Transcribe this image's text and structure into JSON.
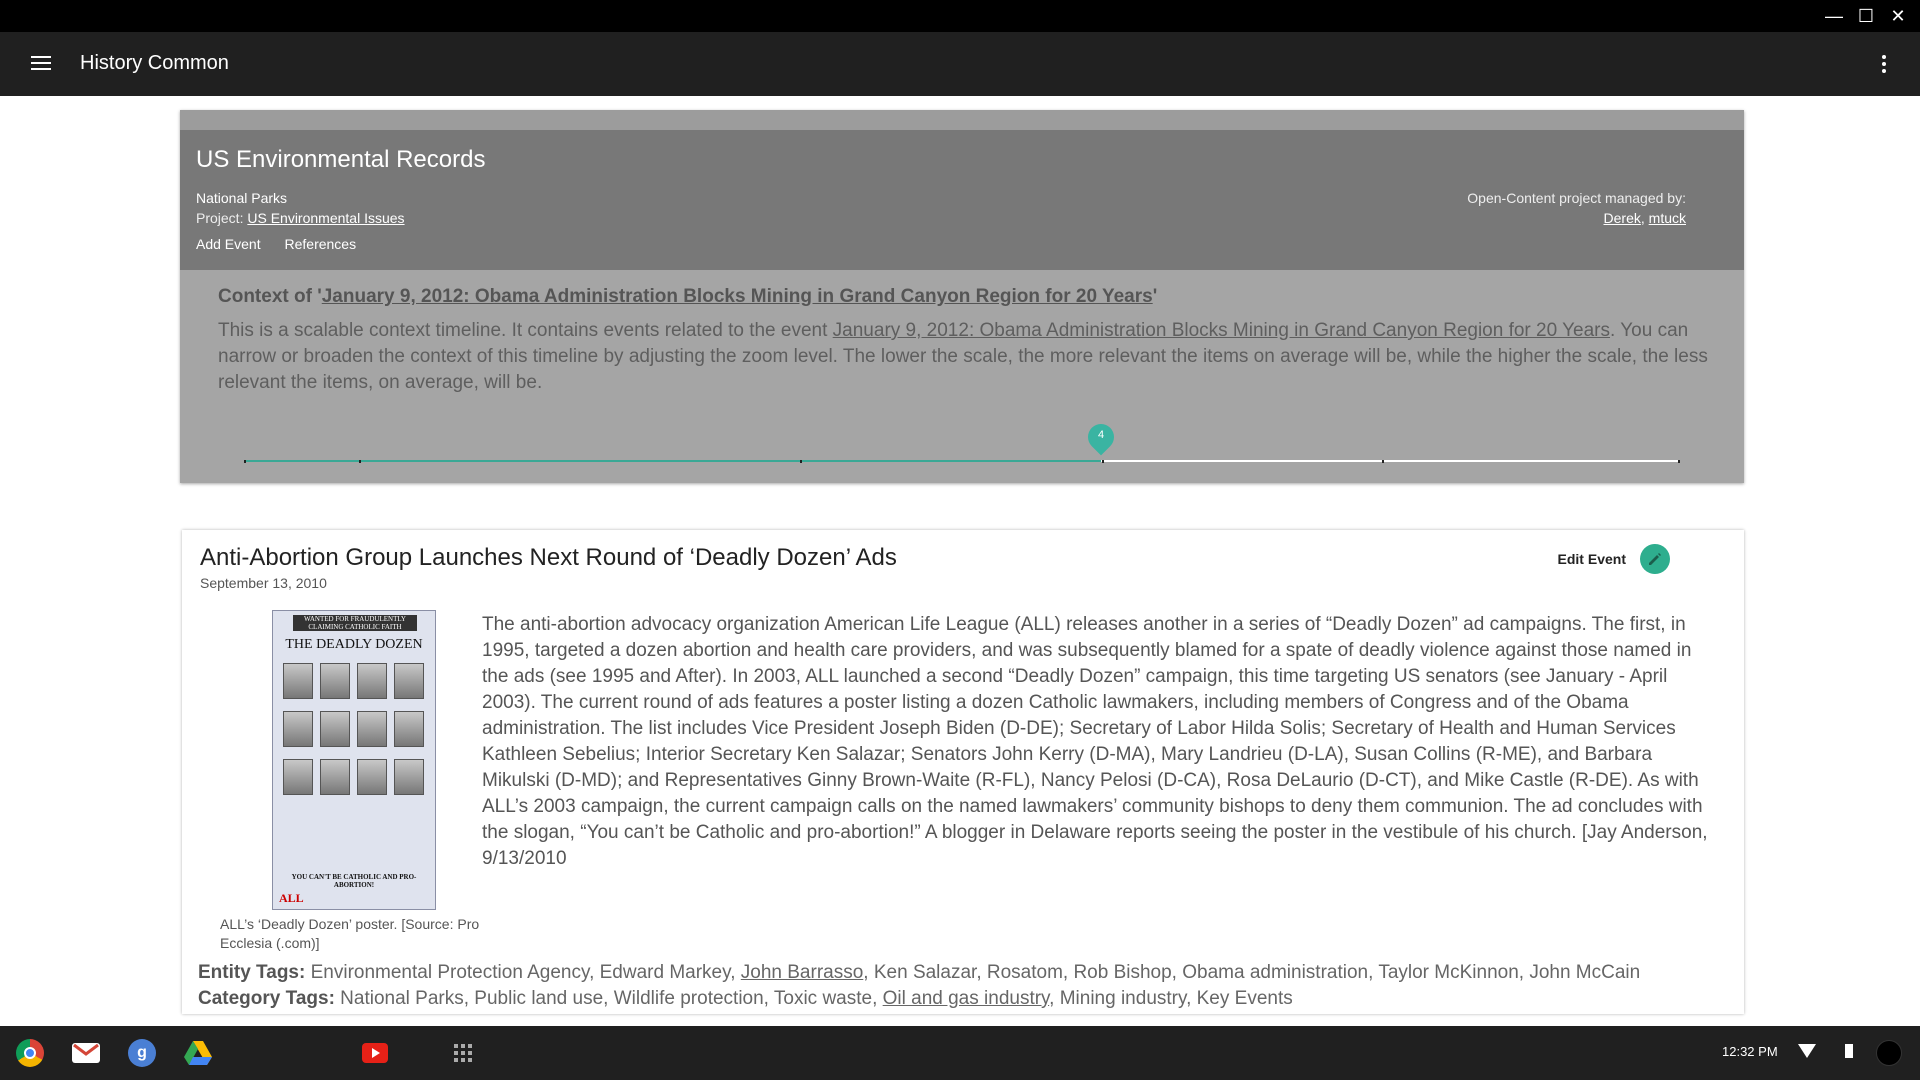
{
  "window": {
    "minimize": "—",
    "maximize": "☐",
    "close": "✕"
  },
  "appbar": {
    "title": "History Common"
  },
  "header": {
    "site_title": "US Environmental Records",
    "section": "National Parks",
    "project_label": "Project: ",
    "project_link": "US Environmental Issues",
    "nav": [
      "Add Event",
      "References"
    ],
    "managed_label": "Open-Content project managed by:",
    "managers": [
      "Derek",
      "mtuck"
    ]
  },
  "context": {
    "title_prefix": "Context of '",
    "title_link": "January 9, 2012: Obama Administration Blocks Mining in Grand Canyon Region for 20 Years",
    "title_suffix": "'",
    "desc_1": "This is a scalable context timeline. It contains events related to the event ",
    "desc_link": "January 9, 2012: Obama Administration Blocks Mining in Grand Canyon Region for 20 Years",
    "desc_2": ". You can narrow or broaden the context of this timeline by adjusting the zoom level. The lower the scale, the more relevant the items on average will be, while the higher the scale, the less relevant the items, on average, will be."
  },
  "slider": {
    "value": "4",
    "fill_fraction": 0.597
  },
  "event": {
    "title": "Anti-Abortion Group Launches Next Round of ‘Deadly Dozen’ Ads",
    "date": "September 13, 2010",
    "edit_label": "Edit Event",
    "image_caption": "ALL’s ‘Deadly Dozen’ poster. [Source: Pro Ecclesia (.com)]",
    "poster": {
      "banner": "WANTED FOR FRAUDULENTLY CLAIMING CATHOLIC FAITH",
      "headline": "THE DEADLY DOZEN",
      "slogan": "YOU CAN'T BE CATHOLIC AND PRO-ABORTION!",
      "logo": "ALL"
    },
    "body": "The anti-abortion advocacy organization American Life League (ALL) releases another in a series of “Deadly Dozen” ad campaigns. The first, in 1995, targeted a dozen abortion and health care providers, and was subsequently blamed for a spate of deadly violence against those named in the ads (see 1995 and After). In 2003, ALL launched a second “Deadly Dozen” campaign, this time targeting US senators (see January - April 2003). The current round of ads features a poster listing a dozen Catholic lawmakers, including members of Congress and of the Obama administration. The list includes Vice President Joseph Biden (D-DE); Secretary of Labor Hilda Solis; Secretary of Health and Human Services Kathleen Sebelius; Interior Secretary Ken Salazar; Senators John Kerry (D-MA), Mary Landrieu (D-LA), Susan Collins (R-ME), and Barbara Mikulski (D-MD); and Representatives Ginny Brown-Waite (R-FL), Nancy Pelosi (D-CA), Rosa DeLaurio (D-CT), and Mike Castle (R-DE). As with ALL’s 2003 campaign, the current campaign calls on the named lawmakers’ community bishops to deny them communion. The ad concludes with the slogan, “You can’t be Catholic and pro-abortion!” A blogger in Delaware reports seeing the poster in the vestibule of his church. [Jay Anderson, 9/13/2010",
    "entity_label": "Entity Tags:",
    "entity_before": " Environmental Protection Agency, Edward Markey, ",
    "entity_link": "John Barrasso",
    "entity_after": ", Ken Salazar, Rosatom, Rob Bishop, Obama administration, Taylor McKinnon, John McCain",
    "category_label": "Category Tags:",
    "category_before": " National Parks, Public land use, Wildlife protection, Toxic waste, ",
    "category_link": "Oil and gas industry",
    "category_after": ", Mining industry, Key Events"
  },
  "shelf": {
    "time": "12:32 PM",
    "apps": [
      "chrome-icon",
      "gmail-icon",
      "google-search-icon",
      "drive-icon",
      "youtube-icon",
      "app-launcher-icon"
    ]
  }
}
